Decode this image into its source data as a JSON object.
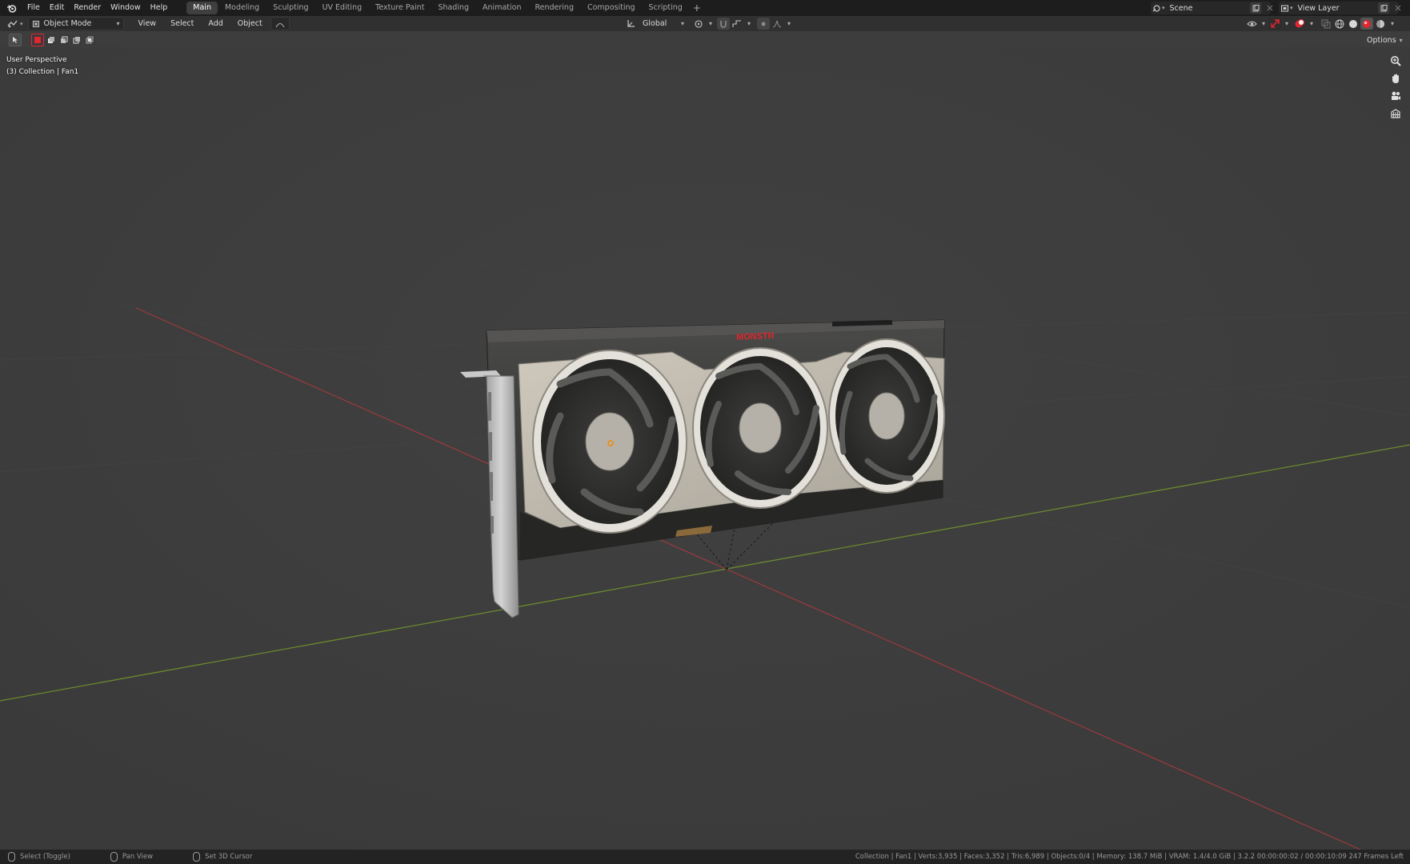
{
  "top_menu": [
    "File",
    "Edit",
    "Render",
    "Window",
    "Help"
  ],
  "workspace_tabs": [
    "Main",
    "Modeling",
    "Sculpting",
    "UV Editing",
    "Texture Paint",
    "Shading",
    "Animation",
    "Rendering",
    "Compositing",
    "Scripting"
  ],
  "workspace_active": "Main",
  "workspace_add": "+",
  "scene_name": "Scene",
  "view_layer": "View Layer",
  "header": {
    "mode": "Object Mode",
    "menus": [
      "View",
      "Select",
      "Add",
      "Object"
    ],
    "transform_orientation": "Global",
    "options": "Options"
  },
  "viewport": {
    "perspective": "User Perspective",
    "collection": "(3) Collection | Fan1",
    "logo_text": "MONSTR"
  },
  "statusbar": {
    "select": "Select (Toggle)",
    "pan": "Pan View",
    "cursor": "Set 3D Cursor",
    "stats": "Collection | Fan1 | Verts:3,935 | Faces:3,352 | Tris:6,989 | Objects:0/4 | Memory: 138.7 MiB | VRAM: 1.4/4.0 GiB | 3.2.2   00:00:00:02 / 00:00:10:09   247 Frames Left"
  },
  "colors": {
    "viewport_bg": "#3d3d3d",
    "x_axis": "#9b3a3f",
    "y_axis": "#6a8a2c",
    "accent_red": "#e0262f"
  }
}
